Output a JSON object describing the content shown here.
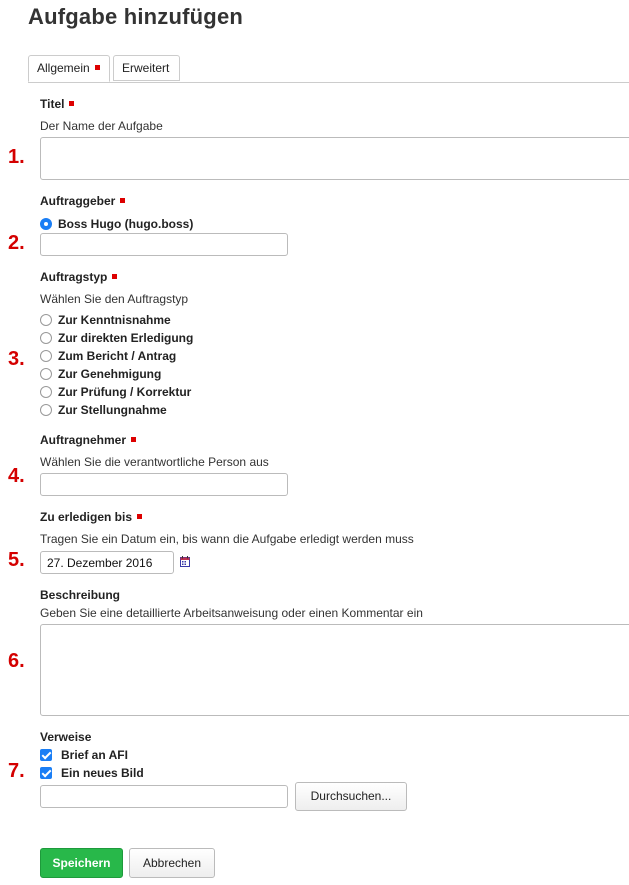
{
  "page": {
    "title": "Aufgabe hinzufügen"
  },
  "tabs": [
    {
      "label": "Allgemein",
      "required": true,
      "active": true
    },
    {
      "label": "Erweitert",
      "required": false,
      "active": false
    }
  ],
  "fields": {
    "titel": {
      "number": "1.",
      "label": "Titel",
      "help": "Der Name der Aufgabe",
      "value": ""
    },
    "auftraggeber": {
      "number": "2.",
      "label": "Auftraggeber",
      "selected": "Boss Hugo (hugo.boss)",
      "search_value": ""
    },
    "auftragstyp": {
      "number": "3.",
      "label": "Auftragstyp",
      "help": "Wählen Sie den Auftragstyp",
      "options": [
        "Zur Kenntnisnahme",
        "Zur direkten Erledigung",
        "Zum Bericht / Antrag",
        "Zur Genehmigung",
        "Zur Prüfung / Korrektur",
        "Zur Stellungnahme"
      ]
    },
    "auftragnehmer": {
      "number": "4.",
      "label": "Auftragnehmer",
      "help": "Wählen Sie die verantwortliche Person aus",
      "value": ""
    },
    "zu_erledigen_bis": {
      "number": "5.",
      "label": "Zu erledigen bis",
      "help": "Tragen Sie ein Datum ein, bis wann die Aufgabe erledigt werden muss",
      "value": "27. Dezember 2016"
    },
    "beschreibung": {
      "number": "6.",
      "label": "Beschreibung",
      "help": "Geben Sie eine detaillierte Arbeitsanweisung oder einen Kommentar ein",
      "value": ""
    },
    "verweise": {
      "number": "7.",
      "label": "Verweise",
      "items": [
        "Brief an AFI",
        "Ein neues Bild"
      ],
      "search_value": "",
      "browse_label": "Durchsuchen..."
    }
  },
  "actions": {
    "save_label": "Speichern",
    "cancel_label": "Abbrechen"
  },
  "colors": {
    "required_marker": "#dd0000",
    "number_red": "#d40000",
    "accent_blue": "#1a7ef5",
    "save_green": "#28b84a"
  },
  "icons": {
    "date_picker": "calendar-icon"
  }
}
